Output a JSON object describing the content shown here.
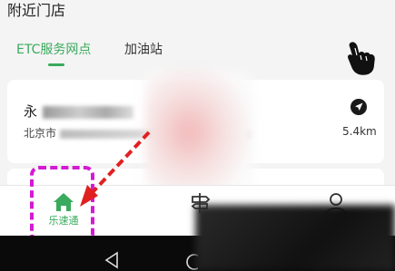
{
  "header": {
    "title": "附近门店"
  },
  "tabs": [
    {
      "label": "ETC服务网点",
      "active": true
    },
    {
      "label": "加油站",
      "active": false
    }
  ],
  "station": {
    "name_prefix": "永",
    "city": "北京市",
    "distance": "5.4km"
  },
  "bottom_nav": {
    "items": [
      {
        "label": "乐速通",
        "icon": "home-icon",
        "active": true
      },
      {
        "label": "",
        "icon": "signpost-icon",
        "active": false
      },
      {
        "label": "",
        "icon": "user-icon",
        "active": false
      }
    ]
  },
  "colors": {
    "accent": "#3aaa5c",
    "annotation_magenta": "#d21bd2",
    "annotation_red": "#e02020"
  }
}
